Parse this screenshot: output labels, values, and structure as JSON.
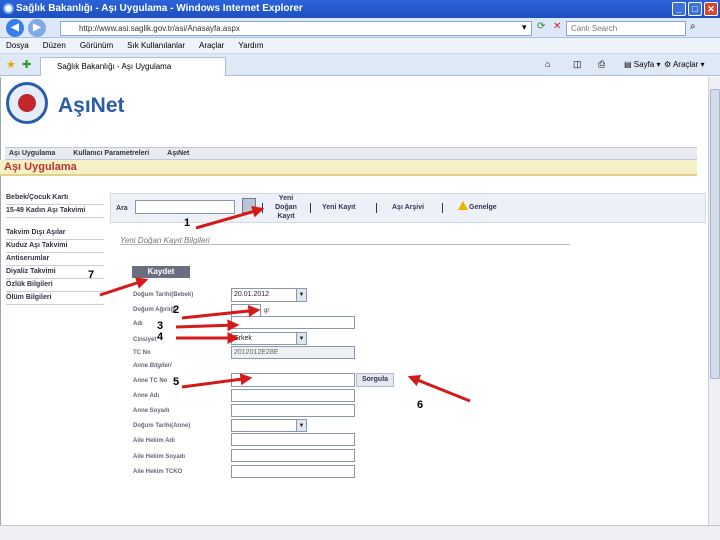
{
  "window": {
    "title": "Sağlık Bakanlığı - Aşı Uygulama - Windows Internet Explorer",
    "minimize": "_",
    "maximize": "□",
    "close": "✕"
  },
  "browser": {
    "url": "http://www.asi.saglik.gov.tr/asi/Anasayfa.aspx",
    "search_placeholder": "Canlı Search",
    "tab_title": "Sağlık Bakanlığı - Aşı Uygulama",
    "toolbar_page": "Sayfa",
    "toolbar_tools": "Araçlar"
  },
  "menu": [
    "Dosya",
    "Düzen",
    "Görünüm",
    "Sık Kullanılanlar",
    "Araçlar",
    "Yardım"
  ],
  "site": {
    "logo_text": "AşıNet",
    "nav": [
      "Aşı Uygulama",
      "Kullanıcı Parametreleri",
      "AşıNet"
    ],
    "page_heading": "Aşı Uygulama"
  },
  "sidebar": [
    "Bebek/Çocuk Kartı",
    "15-49 Kadın Aşı Takvimi",
    "Takvim Dışı Aşılar",
    "Kuduz Aşı Takvimi",
    "Antiserumlar",
    "Diyaliz Takvimi",
    "Özlük Bilgileri",
    "Ölüm Bilgileri"
  ],
  "toolbar": {
    "search_label": "Ara",
    "new_birth": "Yeni Doğan Kayıt",
    "new_record": "Yeni Kayıt",
    "archive": "Aşı Arşivi",
    "general": "Genelge"
  },
  "form": {
    "title": "Yeni Doğan Kayıt Bilgileri",
    "save": "Kaydet",
    "birth_date_label": "Doğum Tarihi(Bebek)",
    "birth_date_value": "20.01.2012",
    "weight_label": "Doğum Ağırlığı",
    "weight_unit": "gr",
    "name_label": "Adı",
    "gender_label": "Cinsiyet",
    "gender_value": "Erkek",
    "tc_label": "TC No",
    "tc_value": "2012012E28E",
    "mother_section": "Anne Bilgileri",
    "mother_tc_label": "Anne TC No",
    "query": "Sorgula",
    "mother_name_label": "Anne Adı",
    "mother_surname_label": "Anne Soyadı",
    "mother_dob_label": "Doğum Tarihi(Anne)",
    "head_name_label": "Aile Hekim Adı",
    "head_surname_label": "Aile Hekim Soyadı",
    "head_tc_label": "Aile Hekim TCKO"
  },
  "annotations": [
    "1",
    "2",
    "3",
    "4",
    "5",
    "6",
    "7"
  ],
  "colors": {
    "accent": "#2a5caa",
    "arrow": "#d41a1a",
    "heading_bg": "#f6f0c6"
  }
}
